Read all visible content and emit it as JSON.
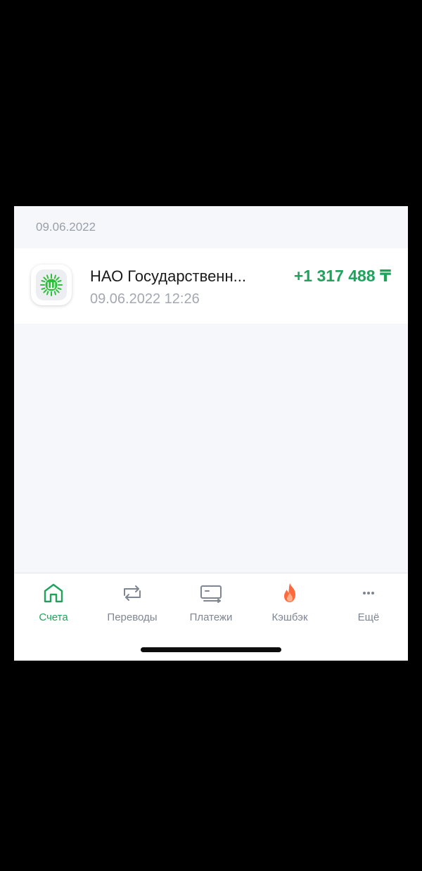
{
  "date_header": "09.06.2022",
  "transaction": {
    "title": "НАО Государственн...",
    "datetime": "09.06.2022 12:26",
    "amount": "+1 317 488 ₸",
    "logo_icon": "government-sun-logo-icon"
  },
  "tab_bar": {
    "tabs": [
      {
        "label": "Счета",
        "icon": "home-icon",
        "active": true
      },
      {
        "label": "Переводы",
        "icon": "transfer-arrows-icon",
        "active": false
      },
      {
        "label": "Платежи",
        "icon": "payment-card-icon",
        "active": false
      },
      {
        "label": "Кэшбэк",
        "icon": "flame-icon",
        "active": false
      },
      {
        "label": "Ещё",
        "icon": "more-dots-icon",
        "active": false
      }
    ]
  },
  "colors": {
    "accent_green": "#1fa35c",
    "inactive_gray": "#7f8691",
    "background": "#f6f7fb",
    "flame_orange": "#ff6a3d"
  }
}
